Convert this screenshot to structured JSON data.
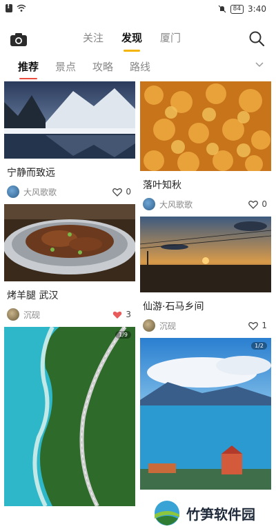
{
  "status_bar": {
    "battery": "84",
    "time": "3:40"
  },
  "header": {
    "tabs": [
      {
        "label": "关注",
        "active": false
      },
      {
        "label": "发现",
        "active": true
      },
      {
        "label": "厦门",
        "active": false
      }
    ]
  },
  "subtabs": [
    {
      "label": "推荐",
      "active": true
    },
    {
      "label": "景点",
      "active": false
    },
    {
      "label": "攻略",
      "active": false
    },
    {
      "label": "路线",
      "active": false
    }
  ],
  "feed": {
    "left": [
      {
        "title": "宁静而致远",
        "author": "大风歌歌",
        "likes": "0",
        "liked": false
      },
      {
        "title": "烤羊腿 武汉",
        "author": "沉砚",
        "likes": "3",
        "liked": true
      },
      {
        "counter": "1/9"
      }
    ],
    "right": [
      {
        "title": "落叶知秋",
        "author": "大风歌歌",
        "likes": "0",
        "liked": false
      },
      {
        "title": "仙游·石马乡间",
        "author": "沉砚",
        "likes": "1",
        "liked": false
      },
      {
        "counter": "1/2"
      }
    ]
  },
  "watermark": {
    "text": "竹笋软件园"
  },
  "colors": {
    "accent_tab": "#f4b400",
    "accent_subtab": "#ea4b3c",
    "like_active": "#e85b5b"
  }
}
